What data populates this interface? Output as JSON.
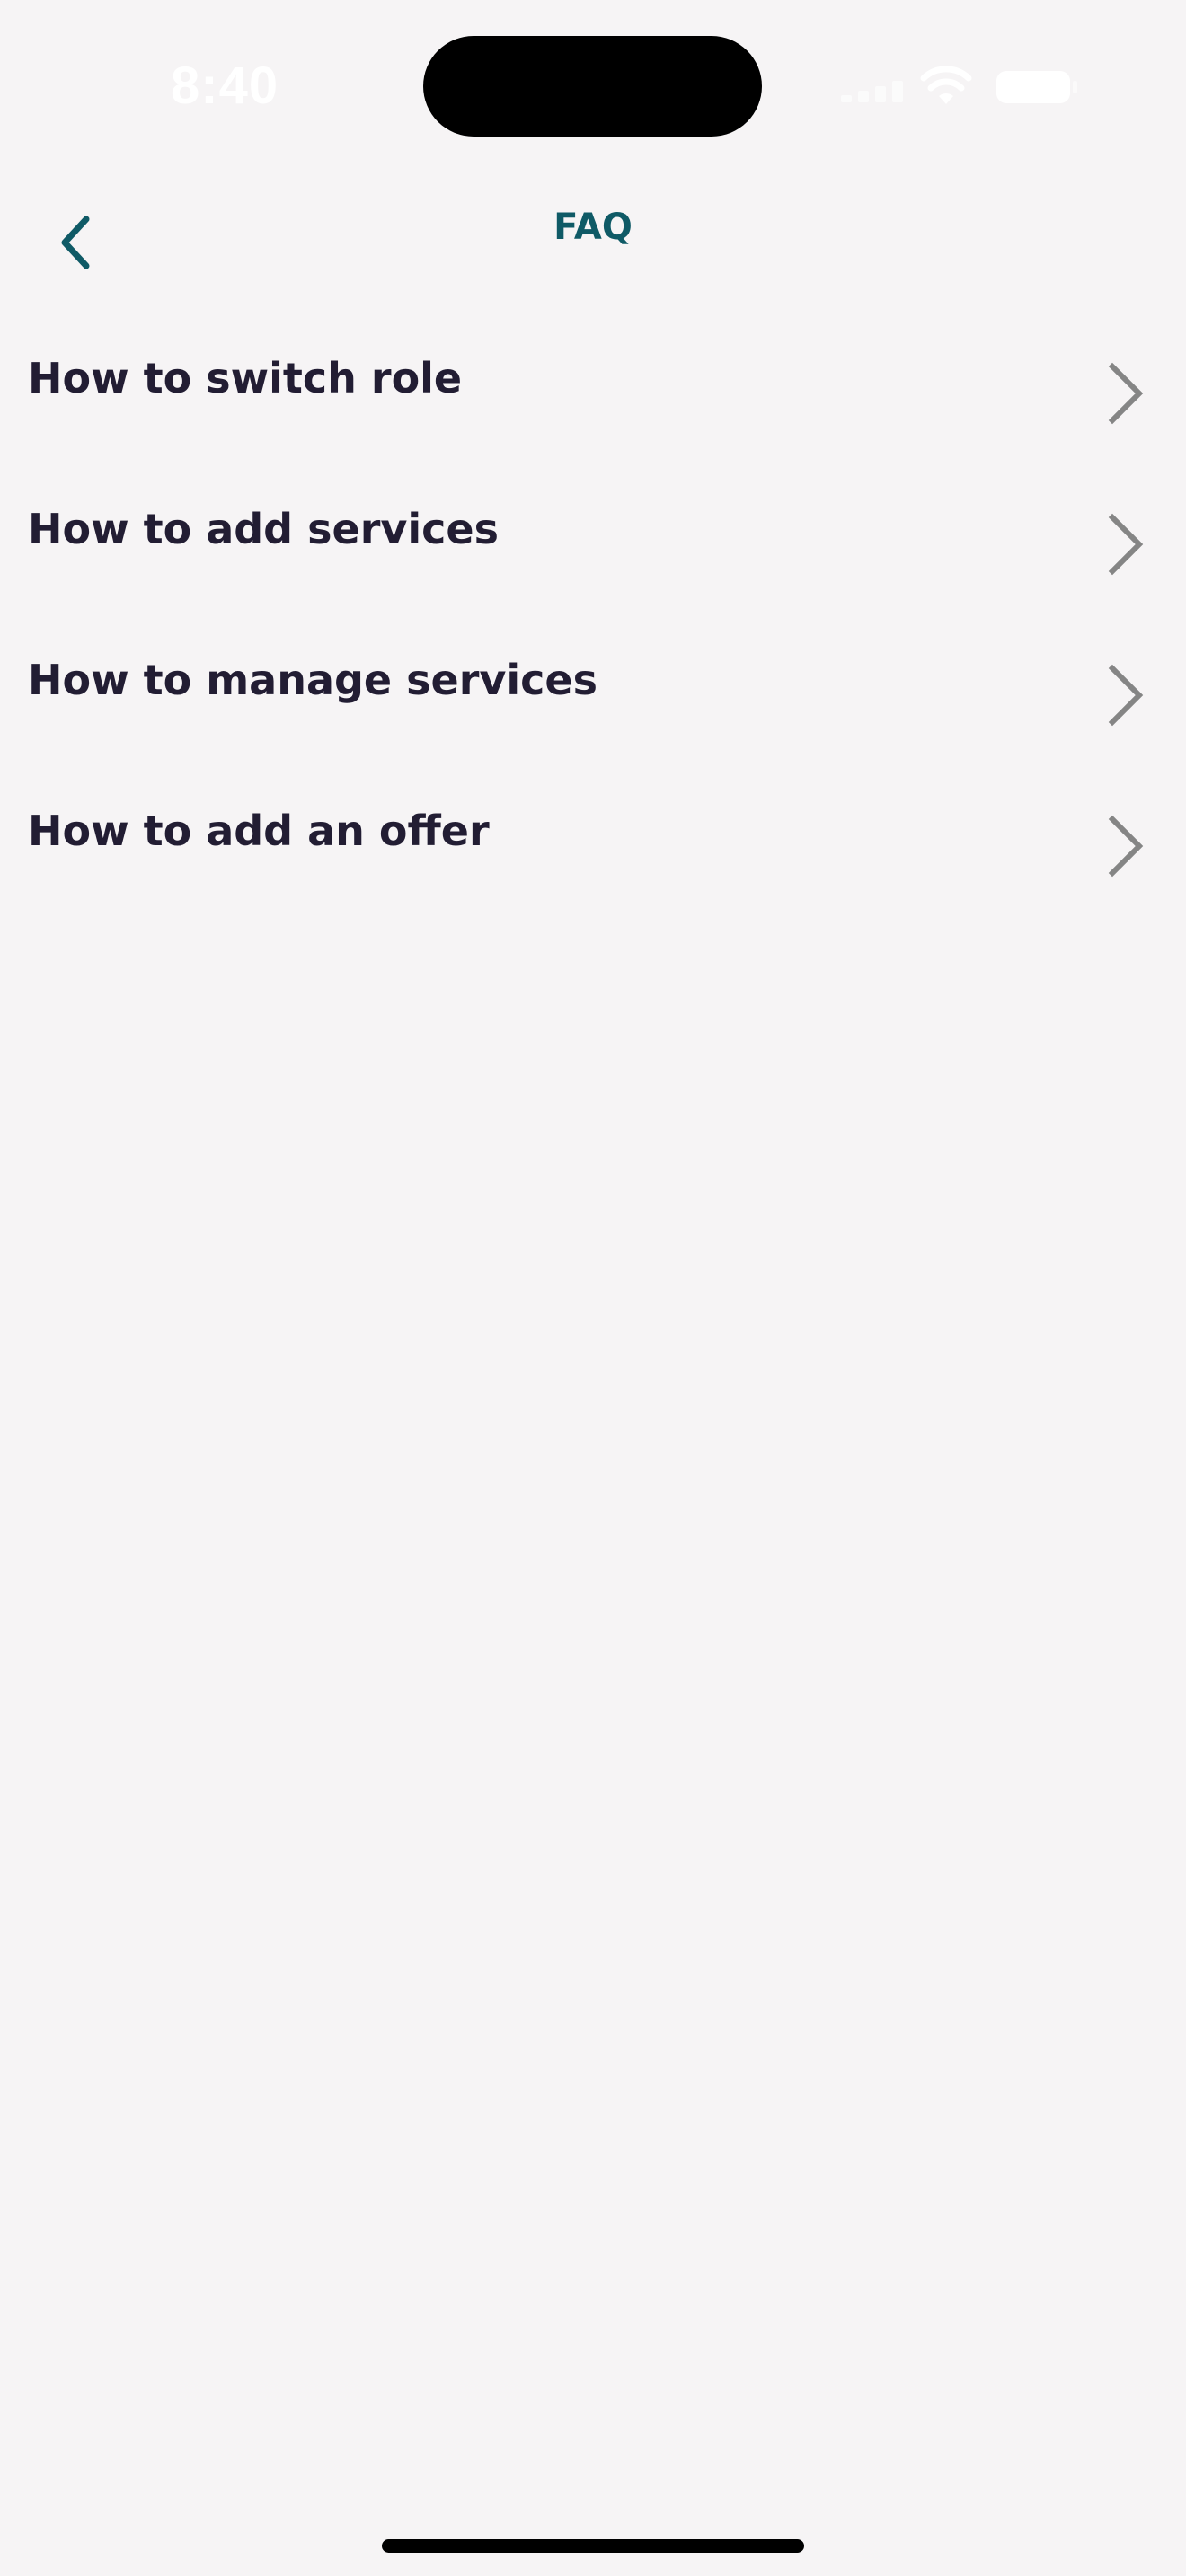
{
  "status_bar": {
    "time": "8:40",
    "icons": [
      "signal-icon",
      "wifi-icon",
      "battery-icon"
    ]
  },
  "header": {
    "title": "FAQ",
    "back_icon": "chevron-left-icon"
  },
  "faq_items": [
    {
      "label": "How to switch role"
    },
    {
      "label": "How to add services"
    },
    {
      "label": "How to manage services"
    },
    {
      "label": "How to add an offer"
    }
  ],
  "colors": {
    "background": "#f6f4f5",
    "accent": "#0f5a66",
    "text": "#221d33",
    "chevron": "#858585"
  }
}
